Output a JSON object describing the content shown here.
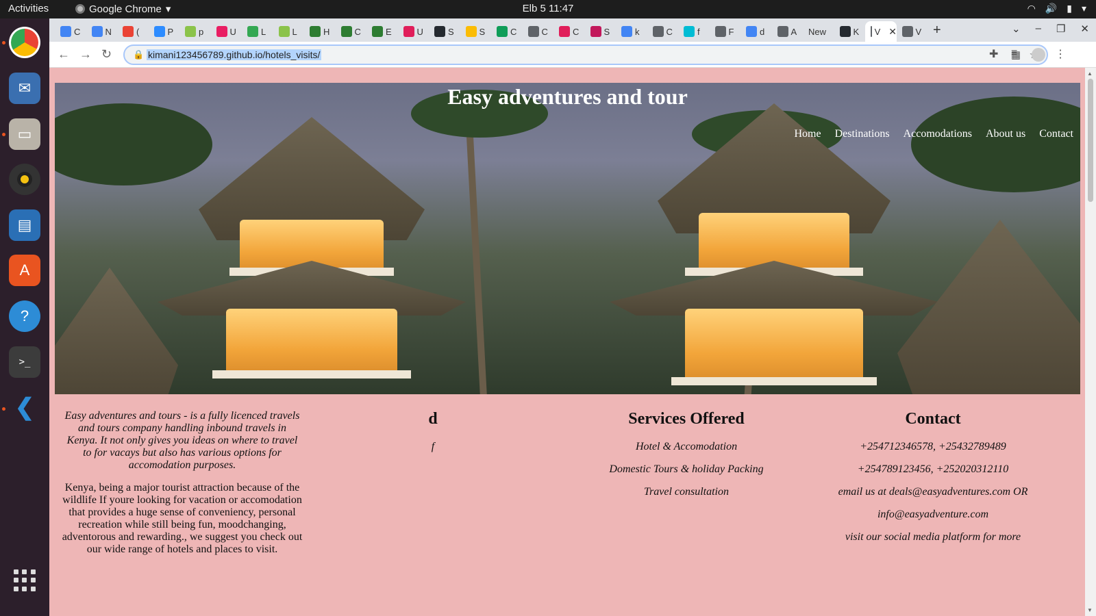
{
  "topbar": {
    "activities": "Activities",
    "app_name": "Google Chrome",
    "clock": "Elb 5  11:47"
  },
  "chrome": {
    "tabs": [
      {
        "label": "C",
        "color": "#4285f4"
      },
      {
        "label": "N",
        "color": "#4285f4"
      },
      {
        "label": "(",
        "color": "#ea4335"
      },
      {
        "label": "P",
        "color": "#2d8cff"
      },
      {
        "label": "p",
        "color": "#8bc34a"
      },
      {
        "label": "U",
        "color": "#e91e63"
      },
      {
        "label": "L",
        "color": "#34a853"
      },
      {
        "label": "L",
        "color": "#8bc34a"
      },
      {
        "label": "H",
        "color": "#2e7d32"
      },
      {
        "label": "C",
        "color": "#2e7d32"
      },
      {
        "label": "E",
        "color": "#2e7d32"
      },
      {
        "label": "U",
        "color": "#e01e5a"
      },
      {
        "label": "S",
        "color": "#24292f"
      },
      {
        "label": "S",
        "color": "#fbbc04"
      },
      {
        "label": "C",
        "color": "#0f9d58"
      },
      {
        "label": "C",
        "color": "#5f6368"
      },
      {
        "label": "C",
        "color": "#e01e5a"
      },
      {
        "label": "S",
        "color": "#c2185b"
      },
      {
        "label": "k",
        "color": "#4285f4"
      },
      {
        "label": "C",
        "color": "#5f6368"
      },
      {
        "label": "f",
        "color": "#00bcd4"
      },
      {
        "label": "F",
        "color": "#5f6368"
      },
      {
        "label": "d",
        "color": "#4285f4"
      },
      {
        "label": "A",
        "color": "#5f6368"
      },
      {
        "label": "New",
        "color": "#dee1e6"
      },
      {
        "label": "K",
        "color": "#24292f"
      },
      {
        "label": "V",
        "color": "#5f6368"
      },
      {
        "label": "V",
        "color": "#5f6368"
      }
    ],
    "url": "kimani123456789.github.io/hotels_visits/"
  },
  "site": {
    "title": "Easy adventures and tour",
    "nav": [
      "Home",
      "Destinations",
      "Accomodations",
      "About us",
      "Contact"
    ],
    "about_intro": "Easy adventures and tours - is a fully licenced travels and tours company handling inbound travels in Kenya. It not only gives you ideas on where to travel to for vacays but also has various options for accomodation purposes.",
    "about_body": "Kenya, being a major tourist attraction because of the wildlife If youre looking for vacation or accomodation that provides a huge sense of conveniency, personal recreation while still being fun, moodchanging, adventorous and rewarding., we suggest you check out our wide range of hotels and places to visit.",
    "col2_heading": "d",
    "col2_text": "f",
    "services_heading": "Services Offered",
    "services": [
      "Hotel & Accomodation",
      "Domestic Tours & holiday Packing",
      "Travel consultation"
    ],
    "contact_heading": "Contact",
    "contact": [
      "+254712346578, +25432789489",
      "+254789123456, +252020312110",
      "email us at deals@easyadventures.com OR",
      "info@easyadventure.com",
      "visit our social media platform for more"
    ]
  }
}
